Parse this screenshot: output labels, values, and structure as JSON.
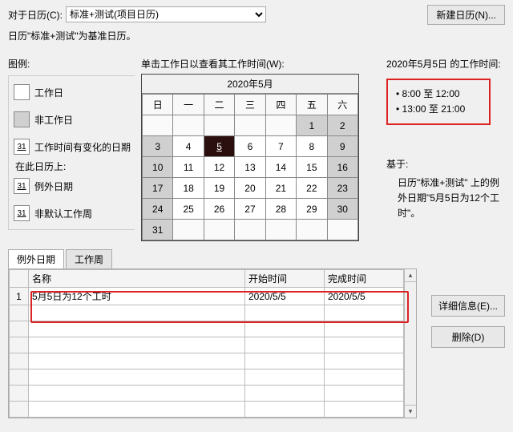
{
  "top": {
    "label": "对于日历(C):",
    "select_value": "标准+测试(项目日历)",
    "new_btn": "新建日历(N)..."
  },
  "subtitle": "日历\"标准+测试\"为基准日历。",
  "legend": {
    "title": "图例:",
    "items": [
      {
        "icon_type": "white",
        "icon_text": "",
        "label": "工作日"
      },
      {
        "icon_type": "gray",
        "icon_text": "",
        "label": "非工作日"
      },
      {
        "icon_type": "u",
        "icon_text": "31",
        "label": "工作时间有变化的日期"
      }
    ],
    "subhead": "在此日历上:",
    "items2": [
      {
        "icon_type": "u",
        "icon_text": "31",
        "label": "例外日期"
      },
      {
        "icon_type": "u",
        "icon_text": "31",
        "label": "非默认工作周"
      }
    ]
  },
  "calendar": {
    "prompt": "单击工作日以查看其工作时间(W):",
    "month_title": "2020年5月",
    "dow": [
      "日",
      "一",
      "二",
      "三",
      "四",
      "五",
      "六"
    ],
    "weeks": [
      [
        {
          "d": "",
          "c": "empty"
        },
        {
          "d": "",
          "c": "empty"
        },
        {
          "d": "",
          "c": "empty"
        },
        {
          "d": "",
          "c": "empty"
        },
        {
          "d": "",
          "c": "empty"
        },
        {
          "d": "1",
          "c": "non"
        },
        {
          "d": "2",
          "c": "non"
        }
      ],
      [
        {
          "d": "3",
          "c": "non"
        },
        {
          "d": "4",
          "c": "work"
        },
        {
          "d": "5",
          "c": "sel"
        },
        {
          "d": "6",
          "c": "work"
        },
        {
          "d": "7",
          "c": "work"
        },
        {
          "d": "8",
          "c": "work"
        },
        {
          "d": "9",
          "c": "non"
        }
      ],
      [
        {
          "d": "10",
          "c": "non"
        },
        {
          "d": "11",
          "c": "work"
        },
        {
          "d": "12",
          "c": "work"
        },
        {
          "d": "13",
          "c": "work"
        },
        {
          "d": "14",
          "c": "work"
        },
        {
          "d": "15",
          "c": "work"
        },
        {
          "d": "16",
          "c": "non"
        }
      ],
      [
        {
          "d": "17",
          "c": "non"
        },
        {
          "d": "18",
          "c": "work"
        },
        {
          "d": "19",
          "c": "work"
        },
        {
          "d": "20",
          "c": "work"
        },
        {
          "d": "21",
          "c": "work"
        },
        {
          "d": "22",
          "c": "work"
        },
        {
          "d": "23",
          "c": "non"
        }
      ],
      [
        {
          "d": "24",
          "c": "non"
        },
        {
          "d": "25",
          "c": "work"
        },
        {
          "d": "26",
          "c": "work"
        },
        {
          "d": "27",
          "c": "work"
        },
        {
          "d": "28",
          "c": "work"
        },
        {
          "d": "29",
          "c": "work"
        },
        {
          "d": "30",
          "c": "non"
        }
      ],
      [
        {
          "d": "31",
          "c": "non"
        },
        {
          "d": "",
          "c": "empty"
        },
        {
          "d": "",
          "c": "empty"
        },
        {
          "d": "",
          "c": "empty"
        },
        {
          "d": "",
          "c": "empty"
        },
        {
          "d": "",
          "c": "empty"
        },
        {
          "d": "",
          "c": "empty"
        }
      ]
    ]
  },
  "right": {
    "title": "2020年5月5日 的工作时间:",
    "hours": [
      "• 8:00 至 12:00",
      "• 13:00 至 21:00"
    ],
    "basis_label": "基于:",
    "basis_text": "日历\"标准+测试\" 上的例外日期\"5月5日为12个工时\"。"
  },
  "tabs": {
    "active": "例外日期",
    "inactive": "工作周"
  },
  "grid": {
    "headers": [
      "",
      "名称",
      "开始时间",
      "完成时间"
    ],
    "rows": [
      {
        "n": "1",
        "name": "5月5日为12个工时",
        "start": "2020/5/5",
        "end": "2020/5/5"
      }
    ]
  },
  "buttons": {
    "details": "详细信息(E)...",
    "delete": "删除(D)"
  }
}
